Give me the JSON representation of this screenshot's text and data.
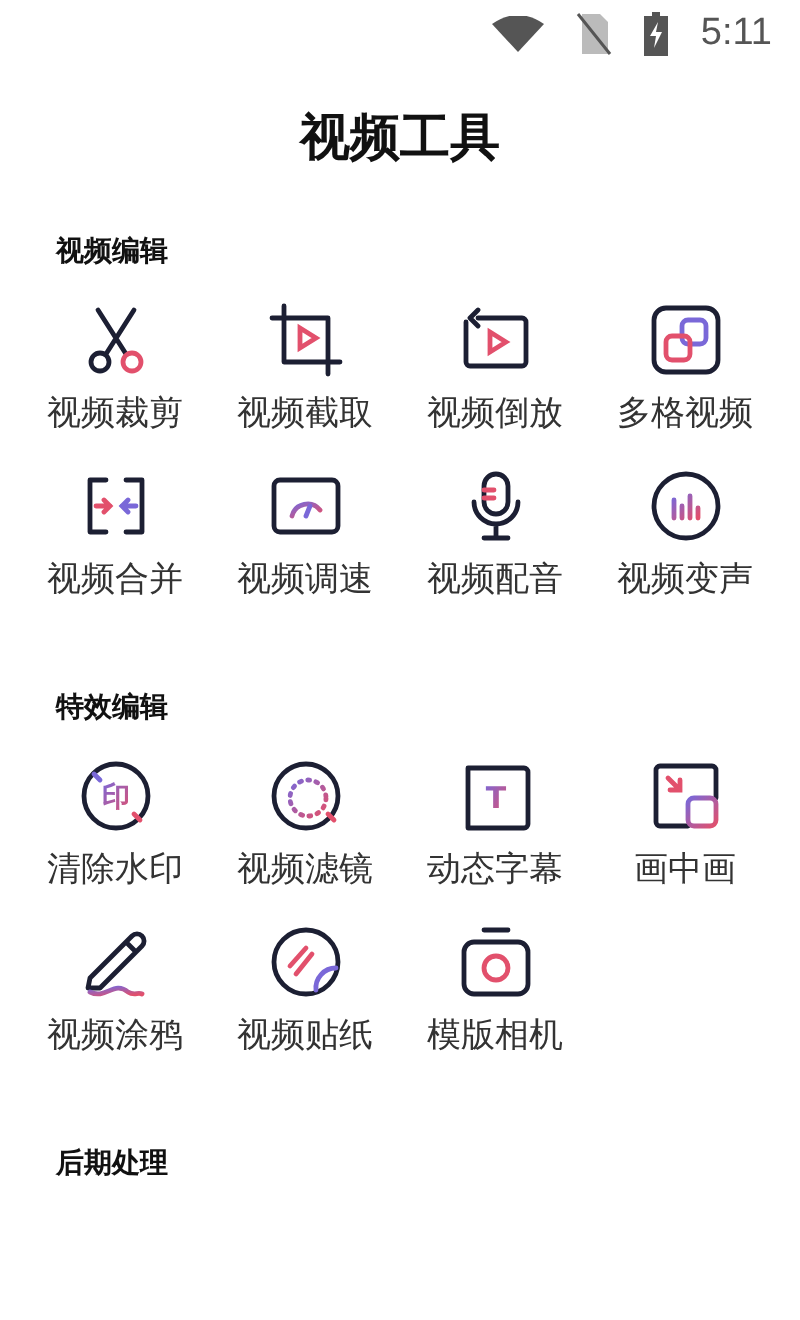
{
  "status_bar": {
    "time": "5:11"
  },
  "title": "视频工具",
  "sections": [
    {
      "heading": "视频编辑",
      "tools": [
        {
          "label": "视频裁剪",
          "kind": "scissors"
        },
        {
          "label": "视频截取",
          "kind": "crop"
        },
        {
          "label": "视频倒放",
          "kind": "reverse"
        },
        {
          "label": "多格视频",
          "kind": "grid"
        },
        {
          "label": "视频合并",
          "kind": "merge"
        },
        {
          "label": "视频调速",
          "kind": "speed"
        },
        {
          "label": "视频配音",
          "kind": "mic"
        },
        {
          "label": "视频变声",
          "kind": "voice"
        }
      ]
    },
    {
      "heading": "特效编辑",
      "tools": [
        {
          "label": "清除水印",
          "kind": "watermark",
          "glyph": "印"
        },
        {
          "label": "视频滤镜",
          "kind": "filter"
        },
        {
          "label": "动态字幕",
          "kind": "subtitle",
          "glyph": "T"
        },
        {
          "label": "画中画",
          "kind": "pip"
        },
        {
          "label": "视频涂鸦",
          "kind": "pencil"
        },
        {
          "label": "视频贴纸",
          "kind": "sticker"
        },
        {
          "label": "模版相机",
          "kind": "camera"
        }
      ]
    },
    {
      "heading": "后期处理"
    }
  ]
}
